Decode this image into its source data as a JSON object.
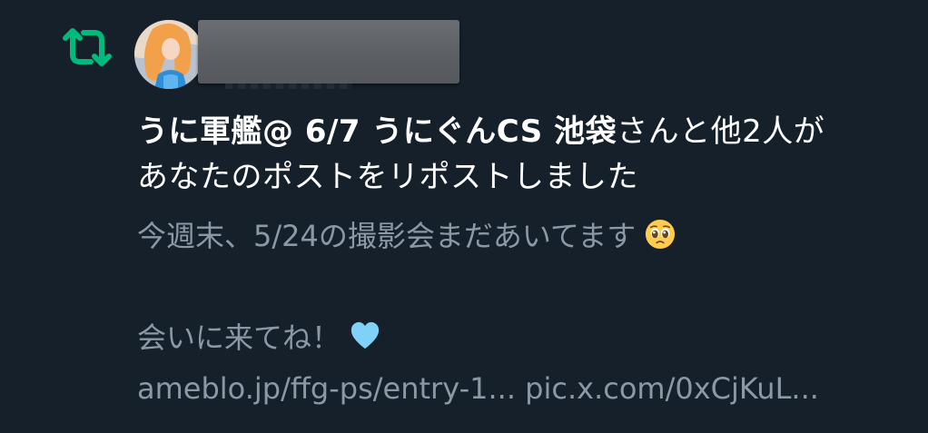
{
  "notification": {
    "retweeter_name": "うに軍艦@ 6/7 うにぐんCS 池袋",
    "retweet_suffix_line1": "さんと他2人が",
    "retweet_line2": "あなたのポストをリポストしました",
    "tweet_line1": "今週末、5/24の撮影会まだあいてます",
    "tweet_line1_emoji": "pleading-face-emoji",
    "tweet_line3": "会いに来てね！",
    "tweet_line3_emoji": "light-blue-heart-emoji",
    "link_1": "ameblo.jp/ffg-ps/entry-1...",
    "link_2": "pic.x.com/0xCjKuL..."
  },
  "colors": {
    "background": "#15202b",
    "retweet_green": "#00ba7c",
    "primary_text": "#ffffff",
    "secondary_text": "#8b98a5"
  },
  "icons": {
    "retweet": "retweet-icon",
    "avatar": "user-avatar"
  }
}
